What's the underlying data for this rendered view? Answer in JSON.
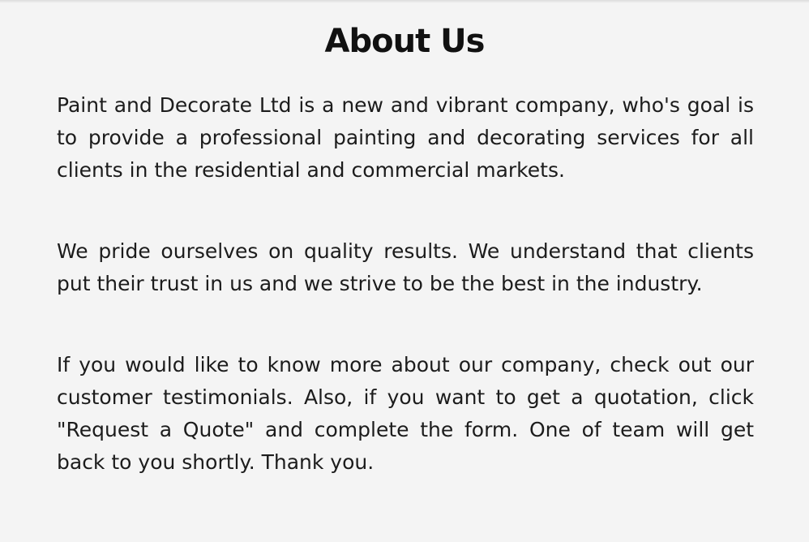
{
  "about": {
    "title": "About Us",
    "paragraphs": [
      "Paint and Decorate Ltd is a new and vibrant company, who's goal is to provide a professional painting and decorating services for all clients in the residential and commercial markets.",
      "We pride ourselves on quality results. We understand that clients put their trust in us and we strive to be the best in the industry.",
      "If you would like to know more about our company, check out our customer testimonials. Also, if you want to get a quotation, click \"Request a Quote\" and complete the form. One of team will get back to you shortly. Thank you."
    ]
  },
  "colors": {
    "background": "#f4f4f4",
    "text": "#1c1c1c",
    "heading": "#111111"
  }
}
